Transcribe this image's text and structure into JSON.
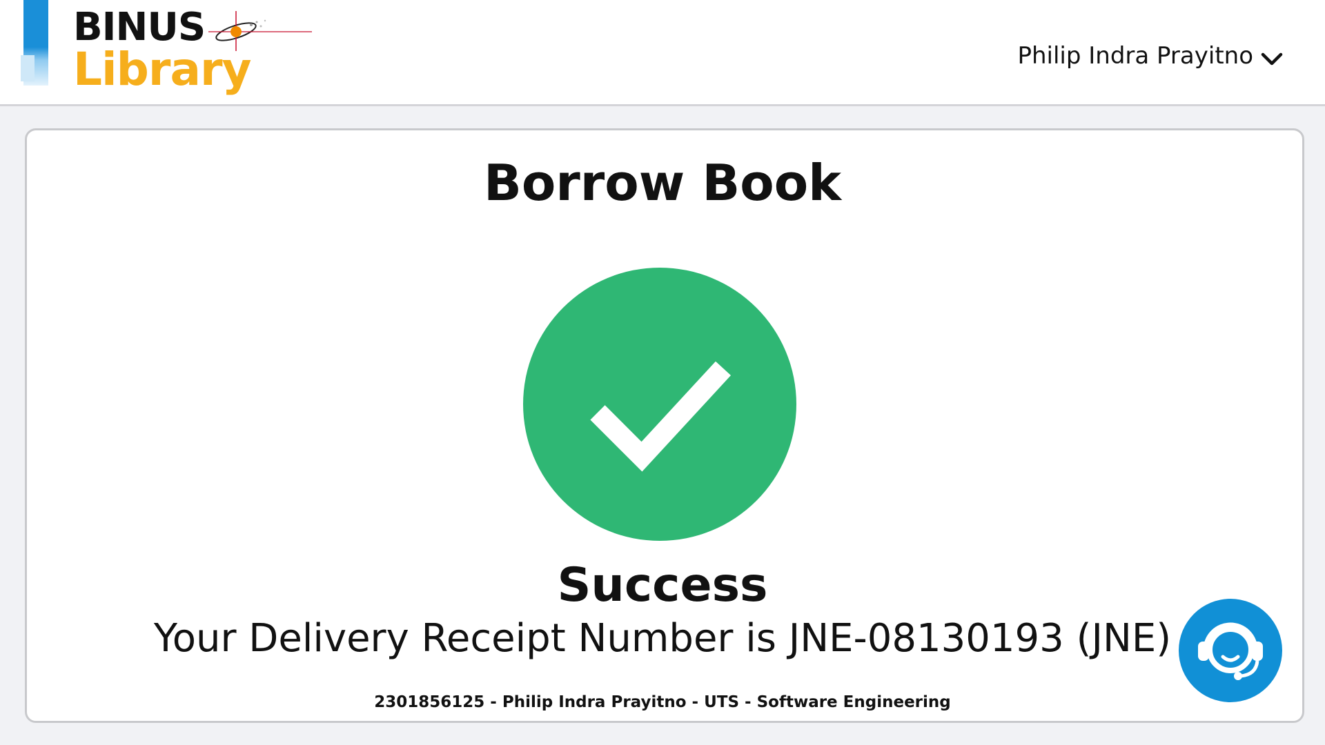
{
  "header": {
    "logo": {
      "line1": "BINUS",
      "line2": "Library"
    },
    "user": {
      "name": "Philip Indra Prayitno",
      "icon": "chevron-down-icon"
    }
  },
  "main": {
    "title": "Borrow Book",
    "status_icon": "check-icon",
    "status": "Success",
    "message": "Your Delivery Receipt Number is JNE-08130193 (JNE)",
    "footer": "2301856125 - Philip Indra Prayitno - UTS - Software Engineering"
  },
  "support_button": {
    "icon": "headset-support-icon"
  },
  "colors": {
    "success": "#2fb774",
    "brand_yellow": "#f6ae1c",
    "brand_blue": "#1a8fd8",
    "support": "#1190d6",
    "background": "#f1f2f5"
  }
}
